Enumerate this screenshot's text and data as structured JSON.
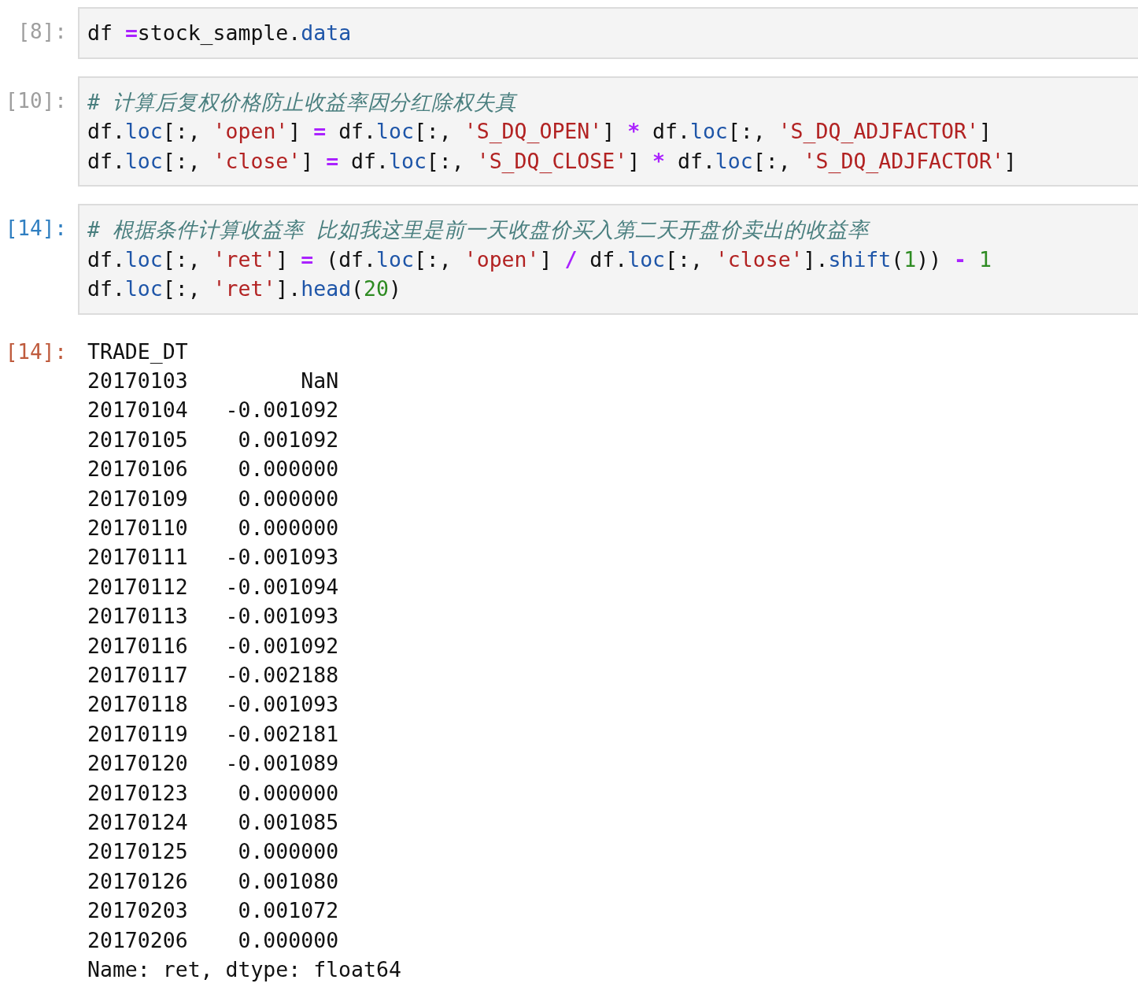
{
  "cells": [
    {
      "kind": "input",
      "prompt": "[8]:",
      "selected": false,
      "lines": [
        [
          {
            "t": "df ",
            "kind": "name"
          },
          {
            "t": "=",
            "kind": "operator"
          },
          {
            "t": "stock_sample.",
            "kind": "name"
          },
          {
            "t": "data",
            "kind": "attribute"
          }
        ]
      ]
    },
    {
      "kind": "input",
      "prompt": "[10]:",
      "selected": false,
      "lines": [
        [
          {
            "t": "# 计算后复权价格防止收益率因分红除权失真",
            "kind": "comment"
          }
        ],
        [
          {
            "t": "df.",
            "kind": "name"
          },
          {
            "t": "loc",
            "kind": "attribute"
          },
          {
            "t": "[:, ",
            "kind": "name"
          },
          {
            "t": "'open'",
            "kind": "string"
          },
          {
            "t": "] ",
            "kind": "name"
          },
          {
            "t": "=",
            "kind": "operator"
          },
          {
            "t": " df.",
            "kind": "name"
          },
          {
            "t": "loc",
            "kind": "attribute"
          },
          {
            "t": "[:, ",
            "kind": "name"
          },
          {
            "t": "'S_DQ_OPEN'",
            "kind": "string"
          },
          {
            "t": "] ",
            "kind": "name"
          },
          {
            "t": "*",
            "kind": "operator"
          },
          {
            "t": " df.",
            "kind": "name"
          },
          {
            "t": "loc",
            "kind": "attribute"
          },
          {
            "t": "[:, ",
            "kind": "name"
          },
          {
            "t": "'S_DQ_ADJFACTOR'",
            "kind": "string"
          },
          {
            "t": "]",
            "kind": "name"
          }
        ],
        [
          {
            "t": "df.",
            "kind": "name"
          },
          {
            "t": "loc",
            "kind": "attribute"
          },
          {
            "t": "[:, ",
            "kind": "name"
          },
          {
            "t": "'close'",
            "kind": "string"
          },
          {
            "t": "] ",
            "kind": "name"
          },
          {
            "t": "=",
            "kind": "operator"
          },
          {
            "t": " df.",
            "kind": "name"
          },
          {
            "t": "loc",
            "kind": "attribute"
          },
          {
            "t": "[:, ",
            "kind": "name"
          },
          {
            "t": "'S_DQ_CLOSE'",
            "kind": "string"
          },
          {
            "t": "] ",
            "kind": "name"
          },
          {
            "t": "*",
            "kind": "operator"
          },
          {
            "t": " df.",
            "kind": "name"
          },
          {
            "t": "loc",
            "kind": "attribute"
          },
          {
            "t": "[:, ",
            "kind": "name"
          },
          {
            "t": "'S_DQ_ADJFACTOR'",
            "kind": "string"
          },
          {
            "t": "]",
            "kind": "name"
          }
        ]
      ]
    },
    {
      "kind": "input",
      "prompt": "[14]:",
      "selected": true,
      "lines": [
        [
          {
            "t": "# 根据条件计算收益率 比如我这里是前一天收盘价买入第二天开盘价卖出的收益率",
            "kind": "comment"
          }
        ],
        [
          {
            "t": "df.",
            "kind": "name"
          },
          {
            "t": "loc",
            "kind": "attribute"
          },
          {
            "t": "[:, ",
            "kind": "name"
          },
          {
            "t": "'ret'",
            "kind": "string"
          },
          {
            "t": "] ",
            "kind": "name"
          },
          {
            "t": "=",
            "kind": "operator"
          },
          {
            "t": " (df.",
            "kind": "name"
          },
          {
            "t": "loc",
            "kind": "attribute"
          },
          {
            "t": "[:, ",
            "kind": "name"
          },
          {
            "t": "'open'",
            "kind": "string"
          },
          {
            "t": "] ",
            "kind": "name"
          },
          {
            "t": "/",
            "kind": "operator"
          },
          {
            "t": " df.",
            "kind": "name"
          },
          {
            "t": "loc",
            "kind": "attribute"
          },
          {
            "t": "[:, ",
            "kind": "name"
          },
          {
            "t": "'close'",
            "kind": "string"
          },
          {
            "t": "].",
            "kind": "name"
          },
          {
            "t": "shift",
            "kind": "attribute"
          },
          {
            "t": "(",
            "kind": "name"
          },
          {
            "t": "1",
            "kind": "number"
          },
          {
            "t": ")) ",
            "kind": "name"
          },
          {
            "t": "-",
            "kind": "operator"
          },
          {
            "t": " 1",
            "kind": "number"
          }
        ],
        [
          {
            "t": "df.",
            "kind": "name"
          },
          {
            "t": "loc",
            "kind": "attribute"
          },
          {
            "t": "[:, ",
            "kind": "name"
          },
          {
            "t": "'ret'",
            "kind": "string"
          },
          {
            "t": "].",
            "kind": "name"
          },
          {
            "t": "head",
            "kind": "attribute"
          },
          {
            "t": "(",
            "kind": "name"
          },
          {
            "t": "20",
            "kind": "number"
          },
          {
            "t": ")",
            "kind": "name"
          }
        ]
      ]
    },
    {
      "kind": "output",
      "prompt": "[14]:",
      "output": [
        "TRADE_DT",
        "20170103         NaN",
        "20170104   -0.001092",
        "20170105    0.001092",
        "20170106    0.000000",
        "20170109    0.000000",
        "20170110    0.000000",
        "20170111   -0.001093",
        "20170112   -0.001094",
        "20170113   -0.001093",
        "20170116   -0.001092",
        "20170117   -0.002188",
        "20170118   -0.001093",
        "20170119   -0.002181",
        "20170120   -0.001089",
        "20170123    0.000000",
        "20170124    0.001085",
        "20170125    0.000000",
        "20170126    0.001080",
        "20170203    0.001072",
        "20170206    0.000000",
        "Name: ret, dtype: float64"
      ]
    }
  ]
}
